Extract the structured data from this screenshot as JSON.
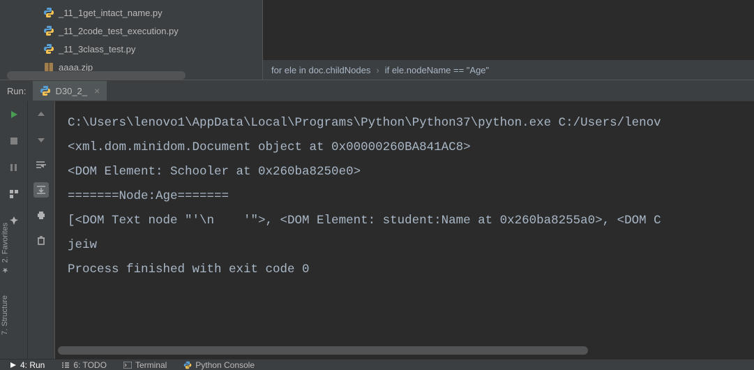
{
  "project_tree": {
    "items": [
      {
        "name": "_11_1get_intact_name.py",
        "type": "py"
      },
      {
        "name": "_11_2code_test_execution.py",
        "type": "py"
      },
      {
        "name": "_11_3class_test.py",
        "type": "py"
      },
      {
        "name": "aaaa.zip",
        "type": "zip"
      }
    ]
  },
  "breadcrumb": {
    "segment1": "for ele in doc.childNodes",
    "segment2": "if ele.nodeName == \"Age\""
  },
  "run": {
    "label": "Run:",
    "tab_name": "D30_2_",
    "console_lines": [
      "C:\\Users\\lenovo1\\AppData\\Local\\Programs\\Python\\Python37\\python.exe C:/Users/lenov",
      "<xml.dom.minidom.Document object at 0x00000260BA841AC8>",
      "<DOM Element: Schooler at 0x260ba8250e0>",
      "=======Node:Age=======",
      "[<DOM Text node \"'\\n    '\">, <DOM Element: student:Name at 0x260ba8255a0>, <DOM C",
      "",
      "",
      "jeiw",
      "",
      "Process finished with exit code 0"
    ]
  },
  "sidebar": {
    "favorites": "2. Favorites",
    "structure": "7. Structure"
  },
  "bottom": {
    "run": "4: Run",
    "todo": "6: TODO",
    "terminal": "Terminal",
    "python_console": "Python Console"
  }
}
